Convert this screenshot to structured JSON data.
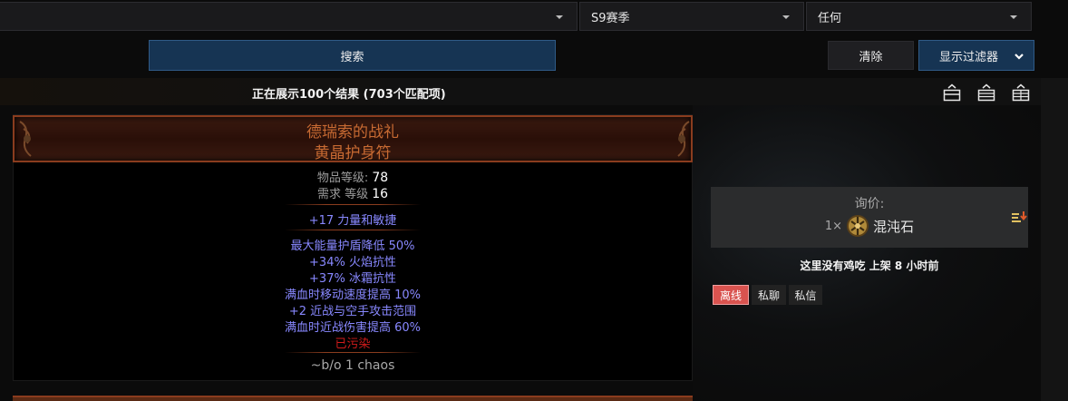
{
  "filters": {
    "select_a_value": "",
    "select_b_value": "S9赛季",
    "select_c_value": "任何"
  },
  "toolbar": {
    "search_label": "搜索",
    "clear_label": "清除",
    "filter_label": "显示过滤器"
  },
  "results": {
    "summary": "正在展示100个结果 (703个匹配项)"
  },
  "item": {
    "name": "德瑞索的战礼",
    "base": "黄晶护身符",
    "properties": [
      {
        "label": "物品等级:",
        "value": "78"
      },
      {
        "label": "需求 等级",
        "value": "16"
      }
    ],
    "implicit": "+17 力量和敏捷",
    "mods": [
      "最大能量护盾降低 50%",
      "+34% 火焰抗性",
      "+37% 冰霜抗性",
      "满血时移动速度提高 10%",
      "+2 近战与空手攻击范围",
      "满血时近战伤害提高 60%"
    ],
    "corrupted": "已污染",
    "note": "~b/o 1 chaos"
  },
  "listing": {
    "price_label": "询价:",
    "price_qty": "1×",
    "currency": "混沌石",
    "seller_name": "这里没有鸡吃",
    "listed_text": "上架 8 小时前",
    "tags": {
      "offline": "离线",
      "whisper": "私聊",
      "pm": "私信"
    }
  },
  "colors": {
    "unique_name": "#c76a32",
    "magic_mod": "#8888ff",
    "corrupted": "#d21b1b",
    "primary_button": "#163453",
    "offline_tag": "#d9534f"
  },
  "icons": {
    "select_chevron": "chevron-down-icon",
    "view_modes": [
      "view-compact-icon",
      "view-list-icon",
      "view-detail-icon"
    ],
    "currency": "chaos-orb-icon",
    "sort": "sort-desc-icon"
  }
}
